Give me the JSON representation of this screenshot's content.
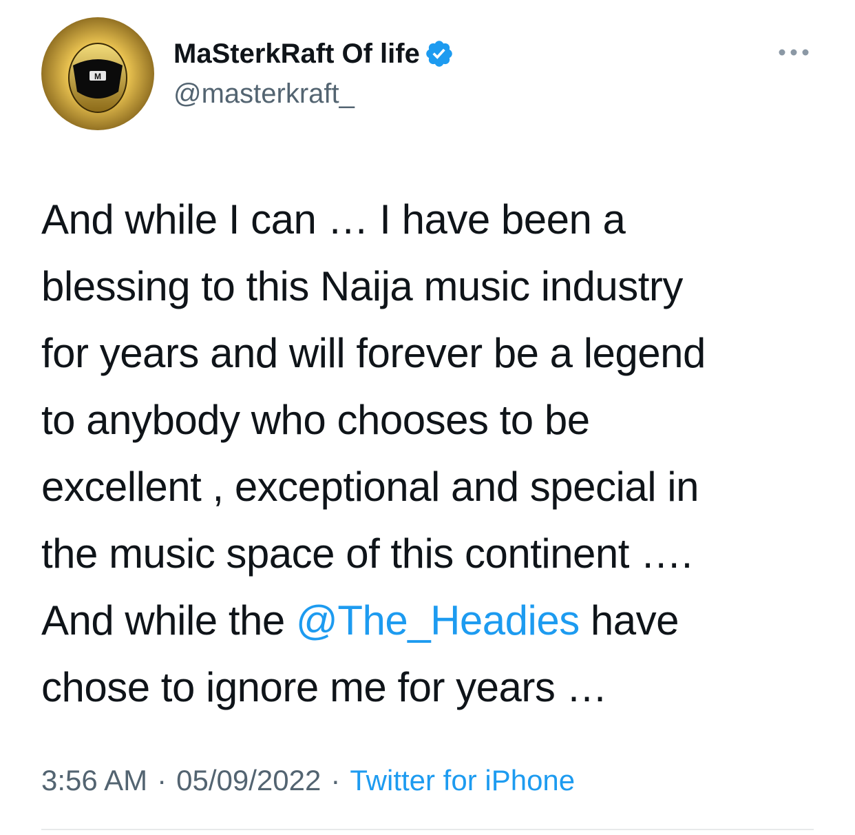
{
  "user": {
    "display_name": "MaSterkRaft Of life",
    "handle": "@masterkraft_",
    "verified": true,
    "avatar_icon": "golden-helmet-avatar-icon"
  },
  "tweet": {
    "lines": [
      [
        "And while I can … I have been a"
      ],
      [
        "blessing to this Naija music industry"
      ],
      [
        "for years and will forever be a legend"
      ],
      [
        "to anybody who chooses to be"
      ],
      [
        "excellent , exceptional and special in"
      ],
      [
        "the music space of this continent …."
      ],
      [
        "And while the ",
        "@The_Headies",
        " have"
      ],
      [
        "chose to ignore me for years …"
      ]
    ],
    "mention": "@The_Headies"
  },
  "meta": {
    "time": "3:56 AM",
    "date": "05/09/2022",
    "separator": "·",
    "source": "Twitter for iPhone"
  },
  "colors": {
    "link": "#1d9bf0",
    "secondary": "#536471",
    "text": "#0f1419",
    "divider": "#e7e9ea"
  },
  "icons": {
    "more": "more-dots-icon",
    "verified": "verified-badge-icon"
  }
}
